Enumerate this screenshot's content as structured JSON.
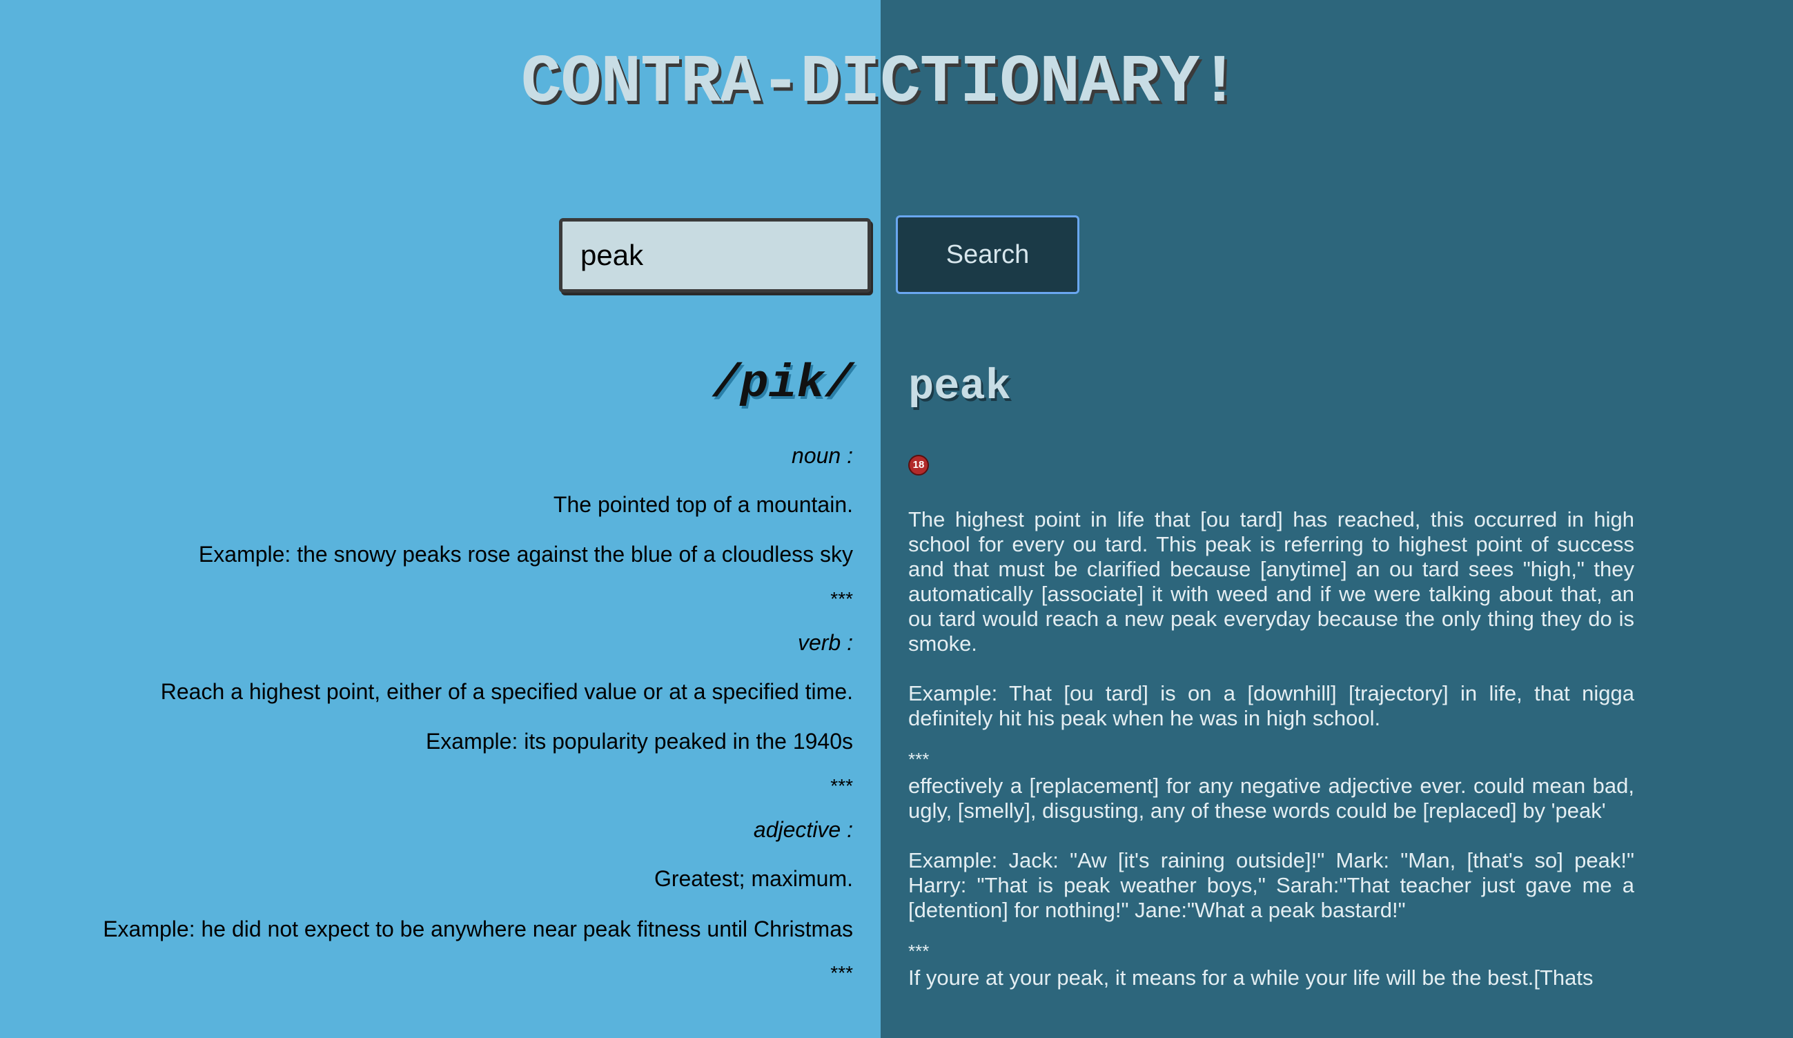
{
  "title": "CONTRA-DICTIONARY!",
  "search": {
    "value": "peak",
    "button_label": "Search"
  },
  "dictionary": {
    "phonetic": "/pik/",
    "entries": [
      {
        "pos": "noun   :",
        "definition": "The pointed top of a mountain.",
        "example": "Example: the snowy peaks rose against the blue of a cloudless sky",
        "separator": "***"
      },
      {
        "pos": "verb   :",
        "definition": "Reach a highest point, either of a specified value or at a specified time.",
        "example": "Example: its popularity peaked in the 1940s",
        "separator": "***"
      },
      {
        "pos": "adjective   :",
        "definition": "Greatest; maximum.",
        "example": "Example: he did not expect to be anywhere near peak fitness until Christmas",
        "separator": "***"
      }
    ]
  },
  "urban": {
    "word": "peak",
    "badge": "18",
    "entries": [
      {
        "definition": "The highest point in life that [ou tard] has reached, this occurred in high school for every ou tard. This peak is referring to highest point of success and that must be clarified because [anytime] an ou tard sees \"high,\" they automatically [associate] it with weed and if we were talking about that, an ou tard would reach a new peak everyday because the only thing they do is smoke.",
        "example": "Example: That [ou tard] is on a [downhill] [trajectory] in life, that nigga definitely hit his peak when he was in high school.",
        "separator": "***"
      },
      {
        "definition": "effectively a [replacement] for any negative adjective ever. could mean bad, ugly, [smelly], disgusting, any of these words could be [replaced] by 'peak'",
        "example": "Example: Jack: \"Aw [it's raining outside]!\" Mark: \"Man, [that's so] peak!\" Harry: \"That is peak weather boys,\" Sarah:\"That teacher just gave me a [detention] for nothing!\" Jane:\"What a peak bastard!\"",
        "separator": "***"
      },
      {
        "definition": "If youre at your peak, it means for a while your life will be the best.[Thats",
        "example": "",
        "separator": ""
      }
    ]
  },
  "colors": {
    "left_background": "#5ab3dc",
    "right_background": "#2d667c",
    "button_background": "#1b3a47",
    "button_border": "#6aa7f0",
    "input_background": "#c8dbe1"
  }
}
